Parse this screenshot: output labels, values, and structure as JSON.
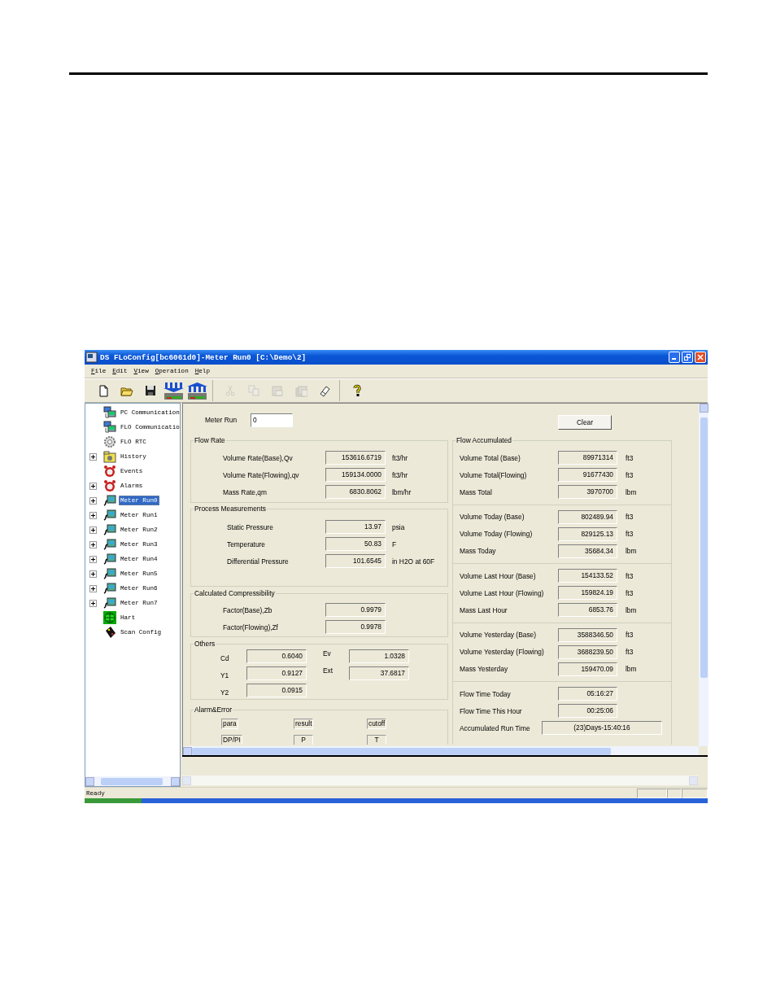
{
  "window": {
    "title": "DS FLoConfig[bc6061d0]-Meter Run0 [C:\\Demo\\2]"
  },
  "menu": [
    "File",
    "Edit",
    "View",
    "Operation",
    "Help"
  ],
  "toolbar_groups": [
    {
      "buttons": [
        {
          "kind": "new",
          "disabled": false
        },
        {
          "kind": "open",
          "disabled": false
        },
        {
          "kind": "save",
          "disabled": false
        },
        {
          "kind": "download",
          "disabled": false
        },
        {
          "kind": "upload",
          "disabled": false
        }
      ]
    },
    {
      "buttons": [
        {
          "kind": "cut",
          "disabled": true
        },
        {
          "kind": "copy",
          "disabled": true
        },
        {
          "kind": "paste",
          "disabled": true
        },
        {
          "kind": "paste-all",
          "disabled": true
        },
        {
          "kind": "eraser",
          "disabled": false
        }
      ]
    },
    {
      "buttons": [
        {
          "kind": "help",
          "disabled": false
        }
      ]
    }
  ],
  "tree": [
    {
      "label": "PC Communication",
      "kind": "computer",
      "collapsed": false,
      "selected": false
    },
    {
      "label": "FLO Communicatio",
      "kind": "computer",
      "collapsed": false,
      "selected": false
    },
    {
      "label": "FLO RTC",
      "kind": "gear",
      "collapsed": false,
      "selected": false
    },
    {
      "label": "History",
      "kind": "folder",
      "collapsed": true,
      "selected": false
    },
    {
      "label": "Events",
      "kind": "clock",
      "collapsed": false,
      "selected": false
    },
    {
      "label": "Alarms",
      "kind": "clock",
      "collapsed": true,
      "selected": false
    },
    {
      "label": "Meter Run0",
      "kind": "meter",
      "collapsed": true,
      "selected": true
    },
    {
      "label": "Meter Run1",
      "kind": "meter",
      "collapsed": true,
      "selected": false
    },
    {
      "label": "Meter Run2",
      "kind": "meter",
      "collapsed": true,
      "selected": false
    },
    {
      "label": "Meter Run3",
      "kind": "meter",
      "collapsed": true,
      "selected": false
    },
    {
      "label": "Meter Run4",
      "kind": "meter",
      "collapsed": true,
      "selected": false
    },
    {
      "label": "Meter Run5",
      "kind": "meter",
      "collapsed": true,
      "selected": false
    },
    {
      "label": "Meter Run6",
      "kind": "meter",
      "collapsed": true,
      "selected": false
    },
    {
      "label": "Meter Run7",
      "kind": "meter",
      "collapsed": true,
      "selected": false
    },
    {
      "label": "Hart",
      "kind": "grid",
      "collapsed": false,
      "selected": false
    },
    {
      "label": "Scan Config",
      "kind": "scanner",
      "collapsed": false,
      "selected": false
    }
  ],
  "meter_run": {
    "label": "Meter Run",
    "value": "0"
  },
  "clear_button": "Clear",
  "groups": [
    {
      "title": "Flow Rate",
      "kind": "rows",
      "rows": [
        {
          "label": "Volume Rate(Base),Qv",
          "value": "153616.6719",
          "unit": "ft3/hr"
        },
        {
          "label": "Volume Rate(Flowing),qv",
          "value": "159134.0000",
          "unit": "ft3/hr"
        },
        {
          "label": "Mass Rate,qm",
          "value": "6830.8062",
          "unit": "lbm/hr"
        }
      ]
    },
    {
      "title": "Process Measurements",
      "kind": "rows",
      "rows": [
        {
          "label": "Static Pressure",
          "value": "13.97",
          "unit": "psia"
        },
        {
          "label": "Temperature",
          "value": "50.83",
          "unit": "F"
        },
        {
          "label": "Differential Pressure",
          "value": "101.6545",
          "unit": "in H2O at 60F"
        }
      ]
    },
    {
      "title": "Calculated Compressibility",
      "kind": "rows",
      "rows": [
        {
          "label": "Factor(Base),Zb",
          "value": "0.9979"
        },
        {
          "label": "Factor(Flowing),Zf",
          "value": "0.9978"
        }
      ]
    },
    {
      "title": "Others",
      "kind": "pairs",
      "rows": [
        [
          {
            "label": "Cd",
            "value": "0.6040"
          },
          {
            "label": "Ev",
            "value": "1.0328"
          }
        ],
        [
          {
            "label": "Y1",
            "value": "0.9127"
          },
          {
            "label": "Ext",
            "value": "37.6817"
          }
        ],
        [
          {
            "label": "Y2",
            "value": "0.0915"
          }
        ]
      ]
    },
    {
      "title": "Alarm&Error",
      "kind": "flags",
      "rows": [
        [
          "para",
          "result",
          "cutoff"
        ],
        [
          "DP/PI",
          "P",
          "T"
        ]
      ]
    }
  ],
  "accumulated": {
    "title": "Flow Accumulated",
    "sections": [
      [
        {
          "label": "Volume Total (Base)",
          "value": "89971314",
          "unit": "ft3"
        },
        {
          "label": "Volume Total(Flowing)",
          "value": "91677430",
          "unit": "ft3"
        },
        {
          "label": "Mass Total",
          "value": "3970700",
          "unit": "lbm"
        }
      ],
      [
        {
          "label": "Volume Today (Base)",
          "value": "802489.94",
          "unit": "ft3"
        },
        {
          "label": "Volume Today (Flowing)",
          "value": "829125.13",
          "unit": "ft3"
        },
        {
          "label": "Mass Today",
          "value": "35684.34",
          "unit": "lbm"
        }
      ],
      [
        {
          "label": "Volume Last Hour (Base)",
          "value": "154133.52",
          "unit": "ft3"
        },
        {
          "label": "Volume Last Hour (Flowing)",
          "value": "159824.19",
          "unit": "ft3"
        },
        {
          "label": "Mass Last Hour",
          "value": "6853.76",
          "unit": "lbm"
        }
      ],
      [
        {
          "label": "Volume Yesterday (Base)",
          "value": "3588346.50",
          "unit": "ft3"
        },
        {
          "label": "Volume Yesterday (Flowing)",
          "value": "3688239.50",
          "unit": "ft3"
        },
        {
          "label": "Mass Yesterday",
          "value": "159470.09",
          "unit": "lbm"
        }
      ],
      [
        {
          "label": "Flow Time Today",
          "value": "05:16:27"
        },
        {
          "label": "Flow Time This Hour",
          "value": "00:25:06"
        }
      ]
    ],
    "run_time": {
      "label": "Accumulated Run Time",
      "value": "(23)Days-15:40:16"
    }
  },
  "status_bar": "Ready"
}
